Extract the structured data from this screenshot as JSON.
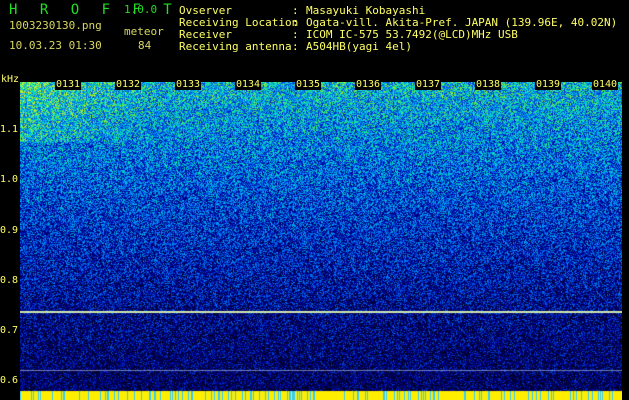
{
  "header": {
    "app_title": "H R O F F T",
    "version": "1.0.0",
    "file_name": "1003230130.png",
    "datetime": "10.03.23 01:30",
    "meteor_label": "meteor",
    "meteor_count": "84"
  },
  "info": [
    {
      "key": "Ovserver",
      "sep": ":",
      "value": "Masayuki Kobayashi"
    },
    {
      "key": "Receiving Location",
      "sep": ":",
      "value": "Ogata-vill. Akita-Pref. JAPAN (139.96E, 40.02N)"
    },
    {
      "key": "Receiver",
      "sep": ":",
      "value": "ICOM IC-575 53.7492(@LCD)MHz USB"
    },
    {
      "key": "Receiving antenna",
      "sep": ":",
      "value": "A504HB(yagi 4el)"
    }
  ],
  "axis": {
    "y_unit": "kHz",
    "y_ticks": [
      "1.1",
      "1.0",
      "0.9",
      "0.8",
      "0.7",
      "0.6"
    ],
    "x_ticks": [
      "0131",
      "0132",
      "0133",
      "0134",
      "0135",
      "0136",
      "0137",
      "0138",
      "0139",
      "0140"
    ]
  },
  "colors": {
    "background": "#000000",
    "title_green": "#22dd22",
    "text_yellow": "#ffff66"
  }
}
